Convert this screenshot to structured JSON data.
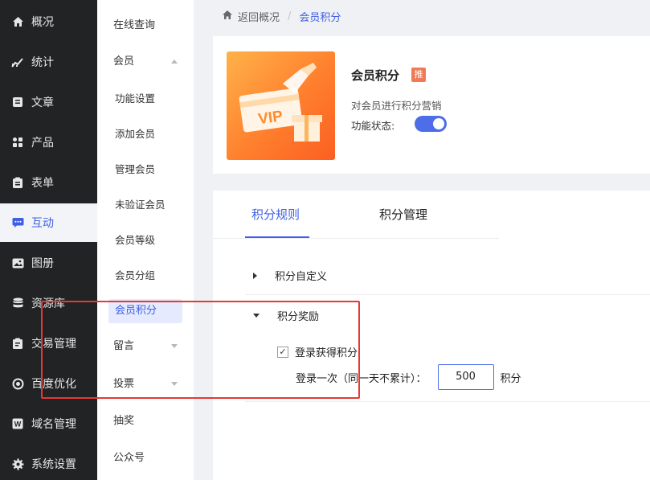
{
  "nav": {
    "items": [
      {
        "label": "概况",
        "icon": "home-icon"
      },
      {
        "label": "统计",
        "icon": "chart-icon"
      },
      {
        "label": "文章",
        "icon": "article-icon"
      },
      {
        "label": "产品",
        "icon": "grid-icon"
      },
      {
        "label": "表单",
        "icon": "clipboard-icon"
      },
      {
        "label": "互动",
        "icon": "chat-icon"
      },
      {
        "label": "图册",
        "icon": "image-icon"
      },
      {
        "label": "资源库",
        "icon": "database-icon"
      },
      {
        "label": "交易管理",
        "icon": "order-icon"
      },
      {
        "label": "百度优化",
        "icon": "seo-icon"
      },
      {
        "label": "域名管理",
        "icon": "domain-icon"
      },
      {
        "label": "系统设置",
        "icon": "gear-icon"
      }
    ],
    "active_index": 5
  },
  "submenu": {
    "online_query": "在线查询",
    "member_group": "会员",
    "member_children": [
      "功能设置",
      "添加会员",
      "管理会员",
      "未验证会员",
      "会员等级",
      "会员分组",
      "会员积分"
    ],
    "message": "留言",
    "vote": "投票",
    "lottery": "抽奖",
    "public_account": "公众号"
  },
  "breadcrumb": {
    "back": "返回概况",
    "separator": "/",
    "current": "会员积分"
  },
  "feature": {
    "title": "会员积分",
    "tag": "推",
    "description": "对会员进行积分营销",
    "status_label": "功能状态:",
    "status_on": true,
    "hero_text": "VIP"
  },
  "tabs": {
    "rules": "积分规则",
    "manage": "积分管理"
  },
  "sections": {
    "custom": "积分自定义",
    "reward": "积分奖励"
  },
  "login_reward": {
    "checkbox_label": "登录获得积分",
    "checked": true,
    "prefix": "登录一次（同一天不累计）：",
    "value": "500",
    "suffix": "积分"
  },
  "colors": {
    "accent": "#3f5fe5",
    "nav_bg": "#222325",
    "highlight_box": "#e53935"
  }
}
